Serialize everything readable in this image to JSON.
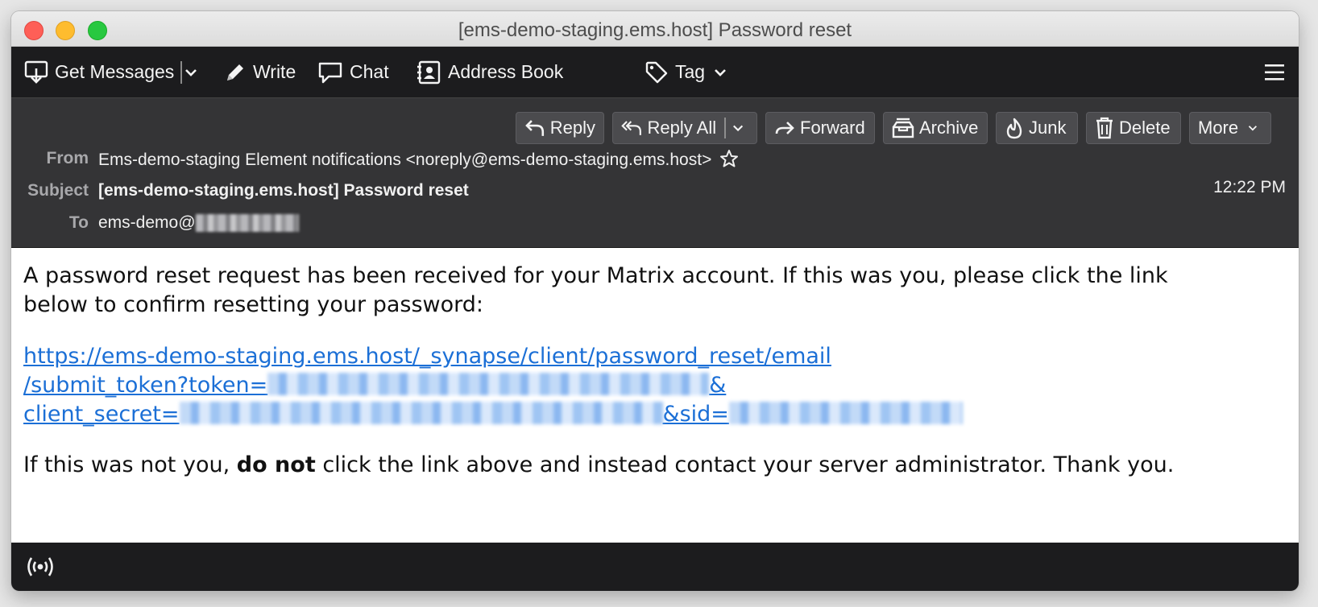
{
  "window": {
    "title": "[ems-demo-staging.ems.host] Password reset"
  },
  "toolbar": {
    "get_messages": "Get Messages",
    "write": "Write",
    "chat": "Chat",
    "address_book": "Address Book",
    "tag": "Tag"
  },
  "actions": {
    "reply": "Reply",
    "reply_all": "Reply All",
    "forward": "Forward",
    "archive": "Archive",
    "junk": "Junk",
    "delete": "Delete",
    "more": "More"
  },
  "header": {
    "from_label": "From",
    "from_value": "Ems-demo-staging Element notifications <noreply@ems-demo-staging.ems.host>",
    "subject_label": "Subject",
    "subject_value": "[ems-demo-staging.ems.host] Password reset",
    "to_label": "To",
    "to_value": "ems-demo@",
    "time": "12:22 PM"
  },
  "message": {
    "intro": "A password reset request has been received for your Matrix account. If this was you, please click the link below to confirm resetting your password:",
    "link_line1": "https://ems-demo-staging.ems.host/_synapse/client/password_reset/email",
    "link_line2": "/submit_token?token=",
    "link_amp": "&",
    "link_line3": "client_secret=",
    "link_sid": "&sid=",
    "outro_before": "If this was not you, ",
    "outro_bold": "do not",
    "outro_after": " click the link above and instead contact your server administrator. Thank you."
  }
}
